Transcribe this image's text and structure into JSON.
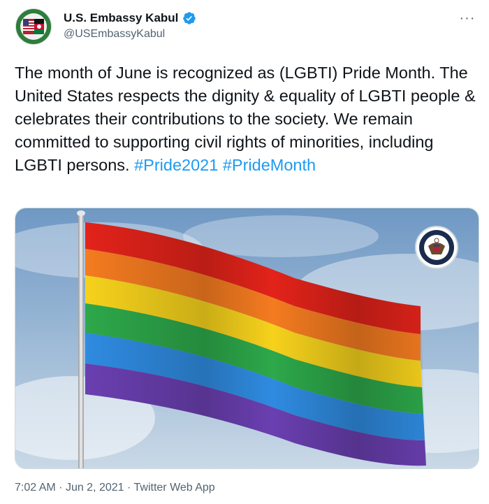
{
  "author": {
    "display_name": "U.S. Embassy Kabul",
    "handle": "@USEmbassyKabul",
    "verified": true
  },
  "tweet": {
    "text": "The month of June is recognized as (LGBTI) Pride Month. The United States respects the dignity & equality of LGBTI people & celebrates their contributions to the society. We remain committed to supporting civil rights of minorities, including LGBTI persons.",
    "hashtags": [
      "#Pride2021",
      "#PrideMonth"
    ]
  },
  "media": {
    "flag_colors": [
      "#e2231a",
      "#f47b20",
      "#f6d21c",
      "#2da84a",
      "#2f8be0",
      "#6a3fb0"
    ]
  },
  "meta": {
    "time": "7:02 AM",
    "date": "Jun 2, 2021",
    "source": "Twitter Web App",
    "separator": "·"
  },
  "colors": {
    "accent": "#1d9bf0",
    "secondary_text": "#536471"
  }
}
